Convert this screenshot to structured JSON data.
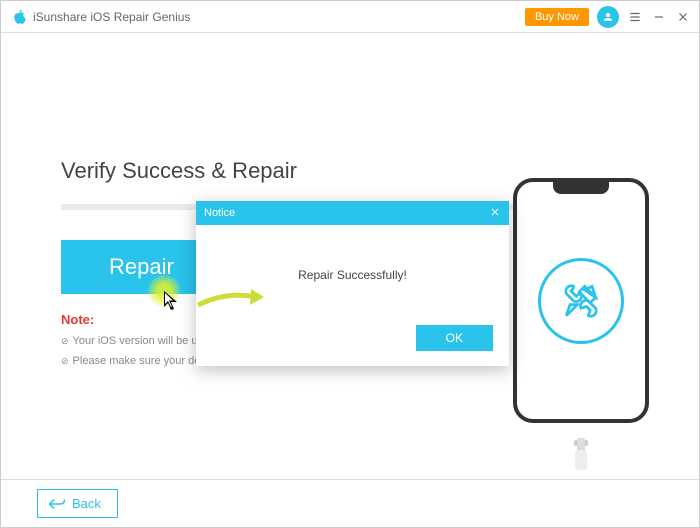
{
  "titlebar": {
    "appname": "iSunshare iOS Repair Genius",
    "buy_label": "Buy Now"
  },
  "colors": {
    "accent": "#29c3ec",
    "buy": "#ff9800",
    "note_red": "#e53935"
  },
  "main": {
    "heading": "Verify Success & Repair",
    "repair_label": "Repair",
    "note_label": "Note:",
    "note_1": "Your iOS version will be up…",
    "note_2": "Please make sure your dev…"
  },
  "modal": {
    "title": "Notice",
    "body": "Repair Successfully!",
    "ok_label": "OK"
  },
  "bottom": {
    "back_label": "Back"
  }
}
